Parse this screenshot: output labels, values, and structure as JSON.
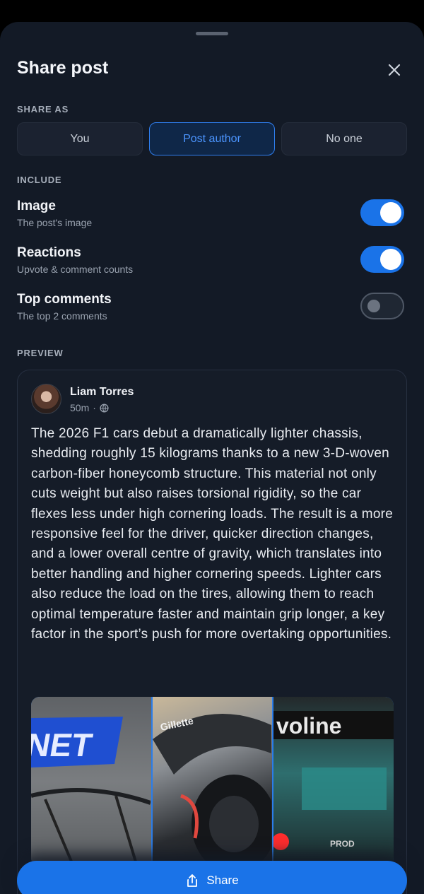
{
  "header": {
    "title": "Share post"
  },
  "share_as": {
    "label": "SHARE AS",
    "options": [
      "You",
      "Post author",
      "No one"
    ],
    "selected": "Post author"
  },
  "include": {
    "label": "INCLUDE",
    "items": [
      {
        "title": "Image",
        "subtitle": "The post's image",
        "enabled": true
      },
      {
        "title": "Reactions",
        "subtitle": "Upvote & comment counts",
        "enabled": true
      },
      {
        "title": "Top comments",
        "subtitle": "The top 2 comments",
        "enabled": false
      }
    ]
  },
  "preview": {
    "label": "PREVIEW",
    "author": "Liam Torres",
    "time": "50m",
    "separator": "·",
    "visibility_icon": "globe-icon",
    "text": "The 2026 F1 cars debut a dramatically lighter chassis, shedding roughly 15 kilograms thanks to a new 3-D-woven carbon-fiber honeycomb structure. This material not only cuts weight but also raises torsional rigidity, so the car flexes less under high cornering loads. The result is a more responsive feel for the driver, quicker direction changes, and a lower overall centre of gravity, which translates into better handling and higher cornering speeds. Lighter cars also reduce the load on the tires, allowing them to reach optimal temperature faster and maintain grip longer, a key factor in the sport’s push for more overtaking opportunities.",
    "images": {
      "image_1_text": "NET",
      "image_2_text": "Gillette",
      "image_3_text": "voline",
      "image_3_sub": "PROD"
    }
  },
  "footer": {
    "share_label": "Share",
    "share_icon": "share-icon"
  },
  "colors": {
    "accent": "#1a73e8",
    "background": "#131a26",
    "card": "#151c28"
  }
}
